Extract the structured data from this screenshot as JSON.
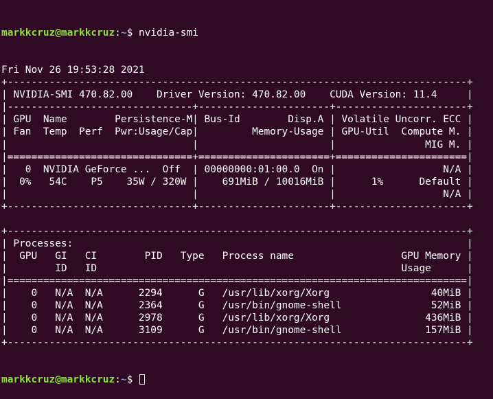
{
  "prompt": {
    "user_host": "markkcruz@markkcruz",
    "separator": ":",
    "cwd": "~",
    "symbol": "$ ",
    "command": "nvidia-smi"
  },
  "output_lines": [
    "Fri Nov 26 19:53:28 2021",
    "+-----------------------------------------------------------------------------+",
    "| NVIDIA-SMI 470.82.00    Driver Version: 470.82.00    CUDA Version: 11.4     |",
    "|-------------------------------+----------------------+----------------------+",
    "| GPU  Name        Persistence-M| Bus-Id        Disp.A | Volatile Uncorr. ECC |",
    "| Fan  Temp  Perf  Pwr:Usage/Cap|         Memory-Usage | GPU-Util  Compute M. |",
    "|                               |                      |               MIG M. |",
    "|===============================+======================+======================|",
    "|   0  NVIDIA GeForce ...  Off  | 00000000:01:00.0  On |                  N/A |",
    "|  0%   54C    P5    35W / 320W |    691MiB / 10016MiB |      1%      Default |",
    "|                               |                      |                  N/A |",
    "+-------------------------------+----------------------+----------------------+",
    "",
    "+-----------------------------------------------------------------------------+",
    "| Processes:                                                                  |",
    "|  GPU   GI   CI        PID   Type   Process name                  GPU Memory |",
    "|        ID   ID                                                   Usage      |",
    "|=============================================================================|",
    "|    0   N/A  N/A      2294      G   /usr/lib/xorg/Xorg                 40MiB |",
    "|    0   N/A  N/A      2364      G   /usr/bin/gnome-shell               52MiB |",
    "|    0   N/A  N/A      2978      G   /usr/lib/xorg/Xorg                436MiB |",
    "|    0   N/A  N/A      3109      G   /usr/bin/gnome-shell              157MiB |",
    "+-----------------------------------------------------------------------------+"
  ],
  "colors": {
    "background": "#300a24",
    "text": "#ffffff",
    "user_host": "#8ae234",
    "path": "#729fcf"
  }
}
